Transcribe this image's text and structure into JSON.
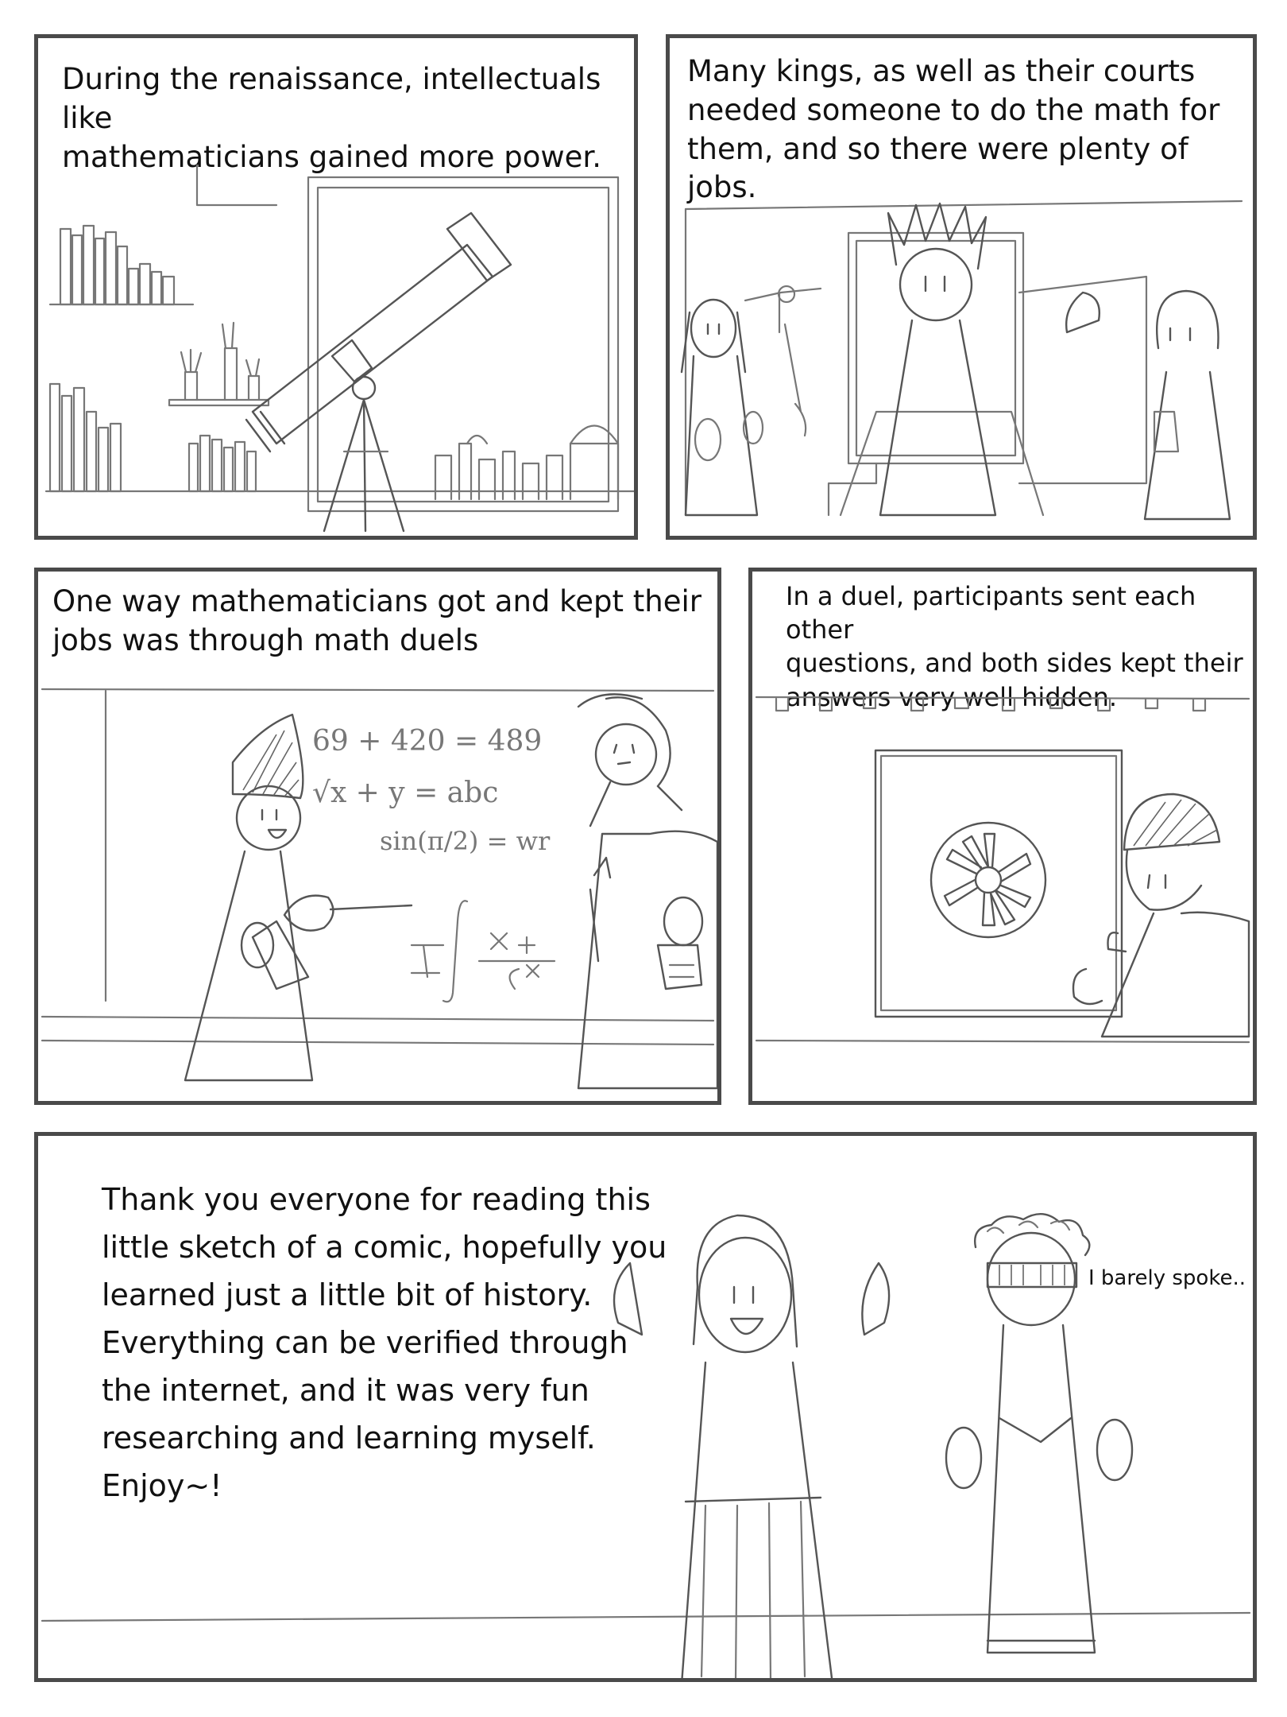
{
  "panels": [
    {
      "id": "p1",
      "caption": "During the renaissance, intellectuals like\nmathematicians gained more power."
    },
    {
      "id": "p2",
      "caption": "Many kings, as well as their courts\nneeded someone to do the math for\nthem, and so there were plenty of jobs."
    },
    {
      "id": "p3",
      "caption": "One way mathematicians got and kept their\njobs was through math duels",
      "equations": [
        "69 + 420 = 489",
        "√x + y = abc",
        "sin(π/2) = wr"
      ]
    },
    {
      "id": "p4",
      "caption": "In a duel, participants sent each other\nquestions, and both sides kept their\nanswers very well hidden."
    },
    {
      "id": "p5",
      "caption": "Thank you everyone for reading this\nlittle sketch of a comic, hopefully you\nlearned just a little bit of history.\nEverything can be verified through\nthe internet, and it was very fun\nresearching and learning myself.\nEnjoy~!",
      "speech": "I barely spoke.."
    }
  ]
}
